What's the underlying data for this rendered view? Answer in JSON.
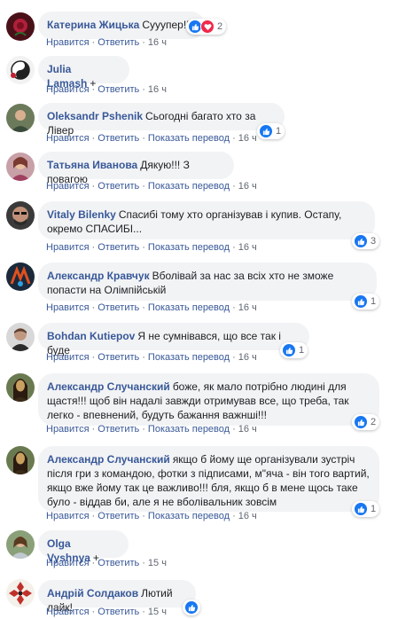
{
  "labels": {
    "like": "Нравится",
    "reply": "Ответить",
    "translate": "Показать перевод"
  },
  "comments": [
    {
      "author": "Катерина Жицька",
      "text": "Сууупер!!!",
      "time": "16 ч",
      "translate": false,
      "reactions": [
        "like",
        "love"
      ],
      "count": "2"
    },
    {
      "author": "Julia Lamash",
      "text": "+",
      "time": "16 ч",
      "translate": false,
      "reactions": [],
      "count": ""
    },
    {
      "author": "Oleksandr Pshenik",
      "text": "Сьогодні багато хто за Лівер",
      "time": "16 ч",
      "translate": true,
      "reactions": [
        "like"
      ],
      "count": "1"
    },
    {
      "author": "Татьяна Иванова",
      "text": "Дякую!!! З повагою",
      "time": "16 ч",
      "translate": true,
      "reactions": [],
      "count": ""
    },
    {
      "author": "Vitaly Bilenky",
      "text": "Спасибі тому хто організував і купив. Остапу, окремо СПАСИБІ...",
      "time": "16 ч",
      "translate": true,
      "reactions": [
        "like"
      ],
      "count": "3"
    },
    {
      "author": "Александр Кравчук",
      "text": "Вболівай за нас за всіх хто не зможе попасти на Олімпійській",
      "time": "16 ч",
      "translate": true,
      "reactions": [
        "like"
      ],
      "count": "1"
    },
    {
      "author": "Bohdan Kutiepov",
      "text": "Я не сумнівався, що все так і буде",
      "time": "16 ч",
      "translate": true,
      "reactions": [
        "like"
      ],
      "count": "1"
    },
    {
      "author": "Александр Случанский",
      "text": "боже, як мало потрібно людині для щастя!!! щоб він надалі завжди отримував все, що треба, так легко - впевнений, будуть бажання важнші!!!",
      "time": "16 ч",
      "translate": true,
      "reactions": [
        "like"
      ],
      "count": "2"
    },
    {
      "author": "Александр Случанский",
      "text": "якщо б йому ще організували зустріч після гри з командою, фотки з підписами, м\"яча - він того вартий, якщо вже йому так це важливо!!! бля, якщо б в мене щось таке було - віддав би, але я не вболівальник зовсім",
      "time": "16 ч",
      "translate": true,
      "reactions": [
        "like"
      ],
      "count": "1"
    },
    {
      "author": "Olga Vyshnya",
      "text": "+",
      "time": "15 ч",
      "translate": false,
      "reactions": [],
      "count": ""
    },
    {
      "author": "Андрій Солдаков",
      "text": "Лютий лайк!",
      "time": "15 ч",
      "translate": false,
      "reactions": [
        "like"
      ],
      "count": ""
    }
  ],
  "avatars": [
    {
      "icon": "rose-avatar-icon",
      "color": "#8a1a2a"
    },
    {
      "icon": "yin-yang-avatar-icon",
      "color": "#222222"
    },
    {
      "icon": "person-avatar-icon",
      "color": "#6b7a5a"
    },
    {
      "icon": "person-avatar-icon",
      "color": "#b07a80"
    },
    {
      "icon": "sunglasses-avatar-icon",
      "color": "#2a2a2a"
    },
    {
      "icon": "logo-avatar-icon",
      "color": "#1a2a3a"
    },
    {
      "icon": "person-avatar-icon",
      "color": "#9a9a9a"
    },
    {
      "icon": "mona-lisa-avatar-icon",
      "color": "#7a6030"
    },
    {
      "icon": "mona-lisa-avatar-icon",
      "color": "#7a6030"
    },
    {
      "icon": "person-avatar-icon",
      "color": "#4a5a4a"
    },
    {
      "icon": "ornament-avatar-icon",
      "color": "#c0302a"
    }
  ]
}
